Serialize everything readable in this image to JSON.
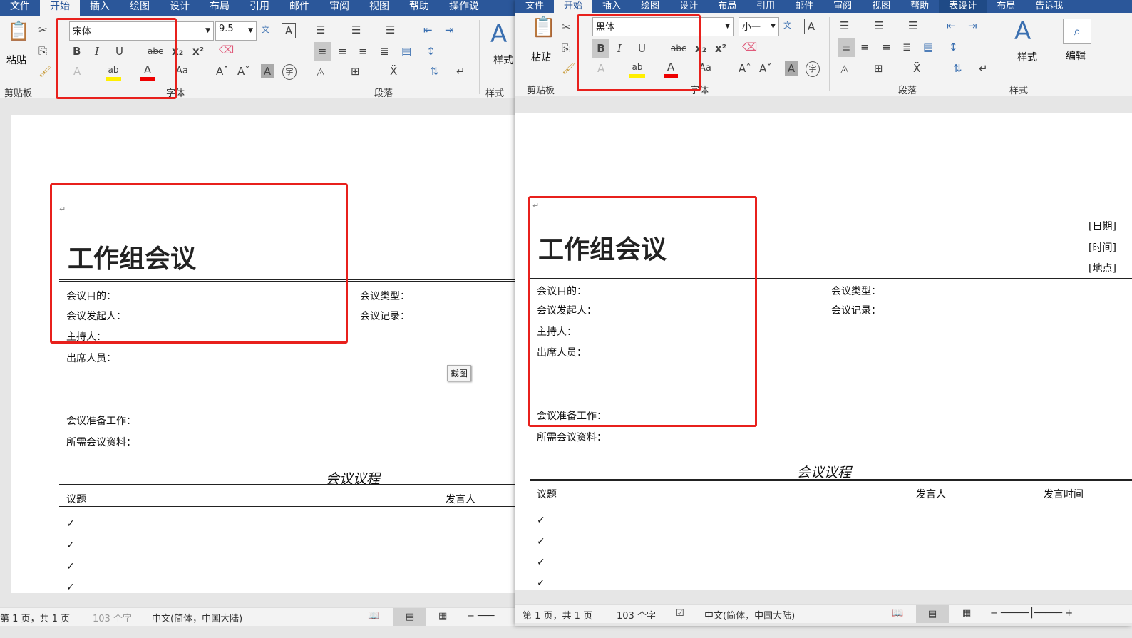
{
  "tabs_left": [
    "文件",
    "开始",
    "插入",
    "绘图",
    "设计",
    "布局",
    "引用",
    "邮件",
    "审阅",
    "视图",
    "帮助",
    "操作说"
  ],
  "tabs_right": [
    "文件",
    "开始",
    "插入",
    "绘图",
    "设计",
    "布局",
    "引用",
    "邮件",
    "审阅",
    "视图",
    "帮助",
    "表设计",
    "布局",
    "告诉我"
  ],
  "ribbon": {
    "paste": "粘贴",
    "clipboard": "剪贴板",
    "font_group": "字体",
    "para_group": "段落",
    "style": "样式",
    "styles_group": "样式",
    "edit": "编辑",
    "bold": "B",
    "italic": "I",
    "underline": "U",
    "strike": "abc",
    "aa": "Aa",
    "font_color": "A"
  },
  "left": {
    "font": "宋体",
    "size": "9.5"
  },
  "right": {
    "font": "黑体",
    "size": "小一"
  },
  "doc": {
    "title": "工作组会议",
    "purpose": "会议目的：",
    "initiator": "会议发起人：",
    "host": "主持人：",
    "attendees": "出席人员：",
    "type": "会议类型：",
    "record": "会议记录：",
    "prep": "会议准备工作：",
    "materials": "所需会议资料：",
    "agenda": "会议议程",
    "topic": "议题",
    "speaker": "发言人",
    "time": "发言时间",
    "date": "[日期]",
    "timeph": "[时间]",
    "place": "[地点]",
    "mark": "↵",
    "check": "✓",
    "screenshot": "截图"
  },
  "status": {
    "page": "第 1 页，共 1 页",
    "words": "103 个字",
    "lang": "中文(简体，中国大陆)"
  }
}
